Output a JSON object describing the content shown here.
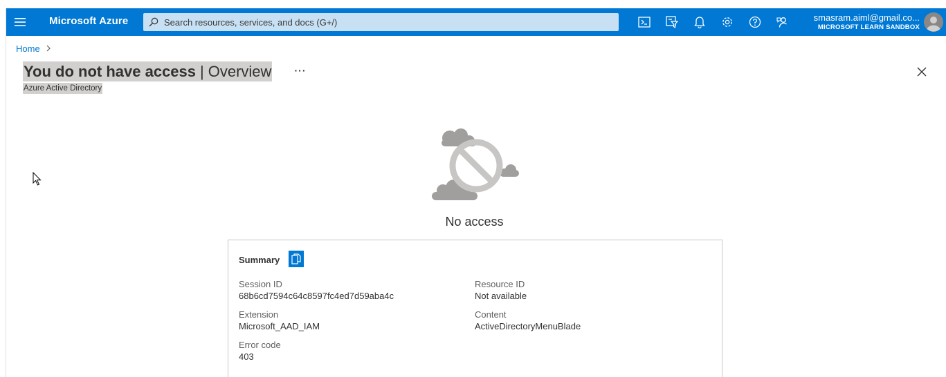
{
  "header": {
    "brand": "Microsoft Azure",
    "search_placeholder": "Search resources, services, and docs (G+/)",
    "account_email": "smasram.aiml@gmail.co...",
    "account_directory": "MICROSOFT LEARN SANDBOX",
    "icons": [
      "menu-icon",
      "cloud-shell-icon",
      "directory-filter-icon",
      "notifications-icon",
      "settings-icon",
      "help-icon",
      "feedback-icon"
    ],
    "accent_color": "#0078d4"
  },
  "breadcrumb": {
    "home": "Home"
  },
  "page": {
    "title_main": "You do not have access",
    "title_separator": "|",
    "title_section": "Overview",
    "more_label": "···",
    "subtitle": "Azure Active Directory"
  },
  "status": {
    "message": "No access"
  },
  "summary": {
    "title": "Summary",
    "session_id_label": "Session ID",
    "session_id_value": "68b6cd7594c64c8597fc4ed7d59aba4c",
    "resource_id_label": "Resource ID",
    "resource_id_value": "Not available",
    "extension_label": "Extension",
    "extension_value": "Microsoft_AAD_IAM",
    "content_label": "Content",
    "content_value": "ActiveDirectoryMenuBlade",
    "error_code_label": "Error code",
    "error_code_value": "403"
  }
}
